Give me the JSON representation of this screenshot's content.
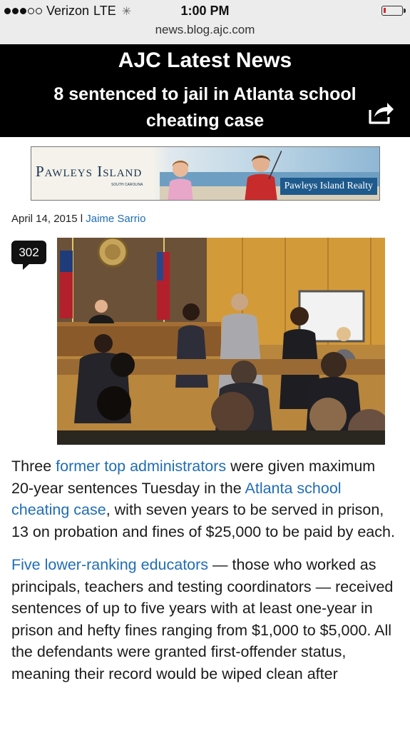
{
  "status_bar": {
    "carrier": "Verizon",
    "network": "LTE",
    "time": "1:00 PM",
    "signal_bars": 3,
    "signal_total": 5,
    "battery_level": 0.1
  },
  "url_bar": {
    "url": "news.blog.ajc.com"
  },
  "header": {
    "brand": "AJC Latest News",
    "headline": "8 sentenced to jail in Atlanta school cheating case",
    "share_icon": "share-icon"
  },
  "ad": {
    "logo": "Pawleys Island",
    "logo_sub": "SOUTH CAROLINA",
    "tagline": "Pawleys Island Realty"
  },
  "meta": {
    "date": "April 14, 2015",
    "separator": " l ",
    "author": "Jaime Sarrio"
  },
  "comments": {
    "count": "302"
  },
  "article": {
    "p1": {
      "t1": "Three ",
      "link1": "former top administrators",
      "t2": " were given maximum 20-year sentences Tuesday in the ",
      "link2": "Atlanta school cheating case",
      "t3": ", with seven years to be served in prison, 13 on probation and fines of $25,000 to be paid by each."
    },
    "p2": {
      "link1": "Five lower-ranking educators",
      "t1": " — those who worked as principals, teachers and testing coordinators — received sentences of up to five years with at least one-year in prison and hefty fines ranging from $1,000 to $5,000. All the defendants were granted first-offender status, meaning their record would be wiped clean after"
    }
  },
  "colors": {
    "header_bg": "#000000",
    "link": "#1f6db5",
    "chrome_bg": "#ececec",
    "battery_low": "#d8262b"
  }
}
